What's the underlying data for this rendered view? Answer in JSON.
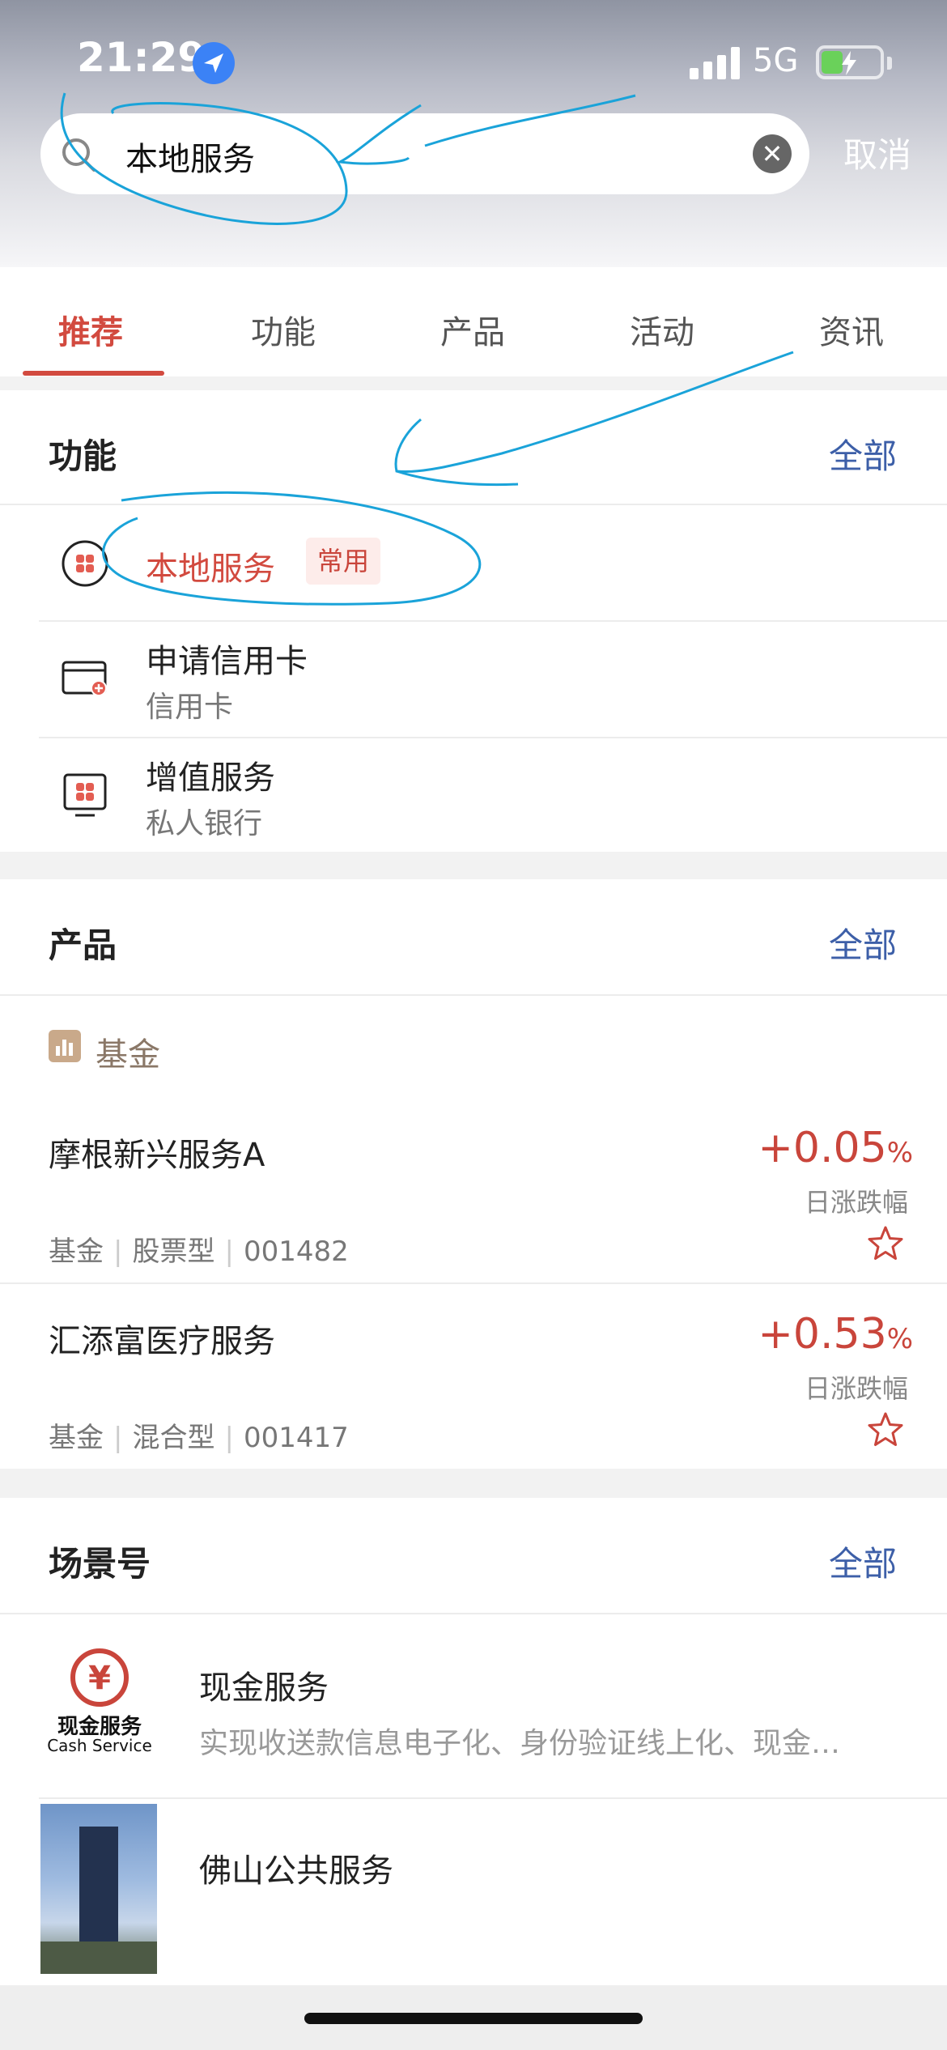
{
  "status_bar": {
    "time": "21:29",
    "network": "5G"
  },
  "search": {
    "query": "本地服务",
    "cancel_label": "取消"
  },
  "tabs": [
    {
      "label": "推荐",
      "active": true
    },
    {
      "label": "功能",
      "active": false
    },
    {
      "label": "产品",
      "active": false
    },
    {
      "label": "活动",
      "active": false
    },
    {
      "label": "资讯",
      "active": false
    }
  ],
  "functions": {
    "title": "功能",
    "all_label": "全部",
    "items": [
      {
        "title": "本地服务",
        "tag": "常用",
        "icon": "local-service-icon"
      },
      {
        "title": "申请信用卡",
        "subtitle": "信用卡",
        "icon": "credit-card-icon"
      },
      {
        "title": "增值服务",
        "subtitle": "私人银行",
        "icon": "value-added-service-icon"
      }
    ]
  },
  "products": {
    "title": "产品",
    "all_label": "全部",
    "category": "基金",
    "items": [
      {
        "name": "摩根新兴服务A",
        "meta": [
          "基金",
          "股票型",
          "001482"
        ],
        "change": "+0.05",
        "unit": "%",
        "change_label": "日涨跌幅"
      },
      {
        "name": "汇添富医疗服务",
        "meta": [
          "基金",
          "混合型",
          "001417"
        ],
        "change": "+0.53",
        "unit": "%",
        "change_label": "日涨跌幅"
      }
    ]
  },
  "scenes": {
    "title": "场景号",
    "all_label": "全部",
    "items": [
      {
        "name": "现金服务",
        "desc": "实现收送款信息电子化、身份验证线上化、现金…",
        "logo_text": "现金服务",
        "logo_en": "Cash Service"
      },
      {
        "name": "佛山公共服务"
      }
    ]
  },
  "colors": {
    "accent_red": "#d24a3f",
    "link_blue": "#3d5fa8",
    "annotation_blue": "#1aa3d9"
  }
}
